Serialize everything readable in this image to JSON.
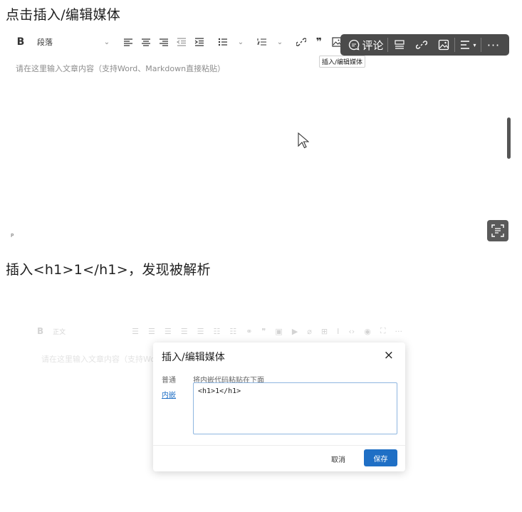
{
  "headings": {
    "top": "点击插入/编辑媒体",
    "middle": "插入<h1>1</h1>，发现被解析"
  },
  "toolbar": {
    "bold_label": "B",
    "paragraph_label": "段落",
    "quote_label": "❞",
    "active_item": "insert-media",
    "tooltip": "插入/编辑媒体"
  },
  "floating_bar": {
    "comment_label": "评论",
    "more_label": "···"
  },
  "editor": {
    "placeholder": "请在这里输入文章内容（支持Word、Markdown直接粘贴）",
    "p_marker": "P"
  },
  "ghost_editor": {
    "bold_label": "B",
    "paragraph_label": "正文",
    "placeholder": "请在这里输入文章内容（支持Word、Markdown直接粘贴）"
  },
  "dialog": {
    "title": "插入/编辑媒体",
    "close_label": "×",
    "tabs": [
      "普通",
      "内嵌"
    ],
    "active_tab": "内嵌",
    "hint": "将内嵌代码粘贴在下面",
    "textarea_value": "<h1>1</h1>",
    "cancel_label": "取消",
    "save_label": "保存"
  },
  "colors": {
    "accent": "#1f6fc5",
    "float_bar_bg": "#4b4b4b",
    "placeholder": "#8d8d8d"
  }
}
